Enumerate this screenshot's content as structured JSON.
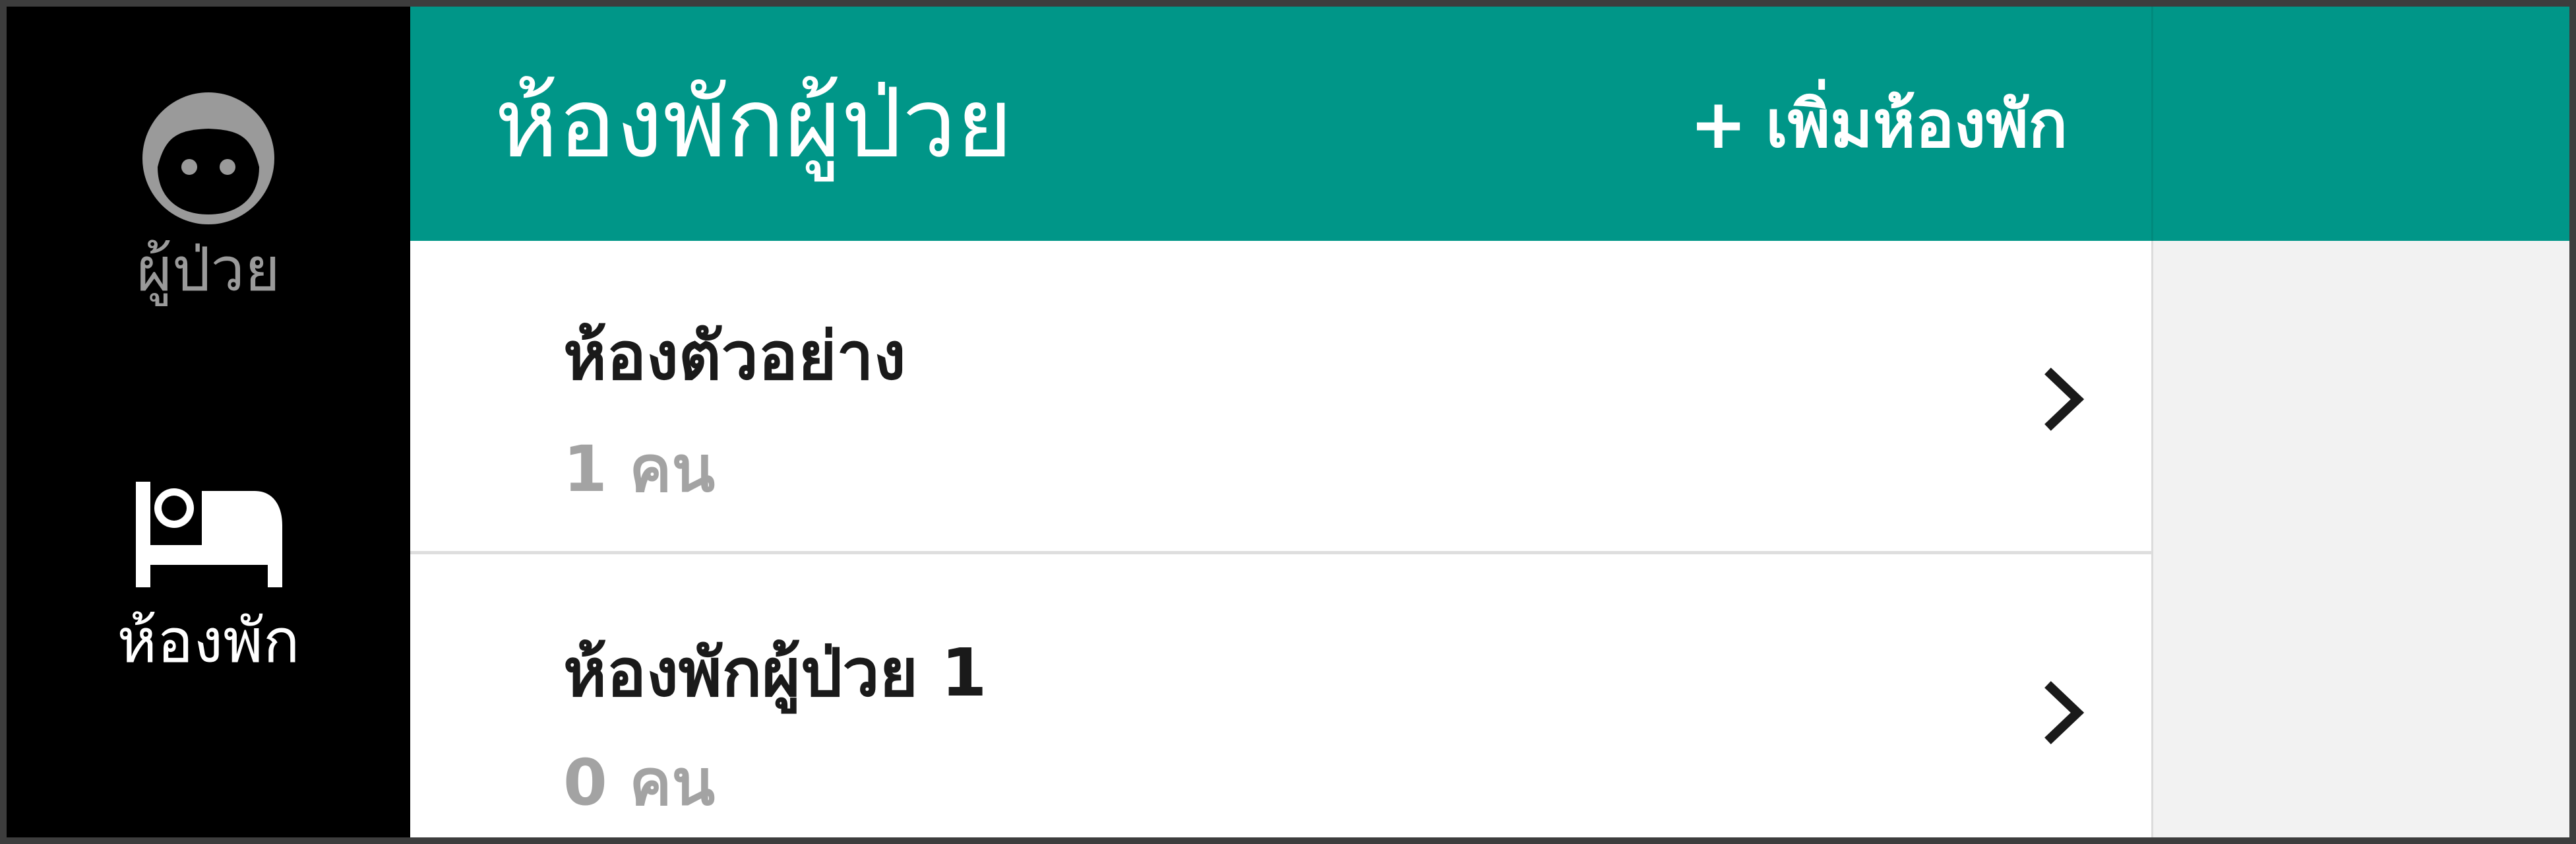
{
  "sidebar": {
    "items": [
      {
        "label": "ผู้ป่วย",
        "icon": "face-icon",
        "active": false,
        "color": "#9a9a9a"
      },
      {
        "label": "ห้องพัก",
        "icon": "bed-icon",
        "active": true,
        "color": "#ffffff"
      }
    ]
  },
  "header": {
    "title": "ห้องพักผู้ป่วย",
    "add_button_icon": "+",
    "add_button_label": "เพิ่มห้องพัก",
    "background": "#009688"
  },
  "rooms": [
    {
      "name": "ห้องตัวอย่าง",
      "count": "1 คน"
    },
    {
      "name": "ห้องพักผู้ป่วย 1",
      "count": "0 คน"
    }
  ],
  "colors": {
    "accent": "#009688",
    "sidebar_bg": "#000000",
    "muted_text": "#a3a3a3"
  }
}
